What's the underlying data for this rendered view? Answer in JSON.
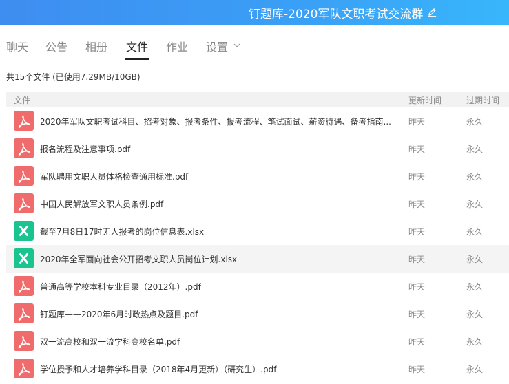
{
  "header": {
    "title": "钉题库-2020军队文职考试交流群"
  },
  "tabs": [
    {
      "label": "聊天"
    },
    {
      "label": "公告"
    },
    {
      "label": "相册"
    },
    {
      "label": "文件",
      "active": true
    },
    {
      "label": "作业"
    },
    {
      "label": "设置"
    }
  ],
  "summary": "共15个文件 (已使用7.29MB/10GB)",
  "table": {
    "columns": {
      "file": "文件",
      "updated": "更新时间",
      "expires": "过期时间"
    },
    "rows": [
      {
        "icon": "pdf-file-icon",
        "name": "2020年军队文职考试科目、招考对象、报考条件、报考流程、笔试面试、薪资待遇、备考指南...",
        "updated": "昨天",
        "expires": "永久"
      },
      {
        "icon": "pdf-file-icon",
        "name": "报名流程及注意事项.pdf",
        "updated": "昨天",
        "expires": "永久"
      },
      {
        "icon": "pdf-file-icon",
        "name": "军队聘用文职人员体格检查通用标准.pdf",
        "updated": "昨天",
        "expires": "永久"
      },
      {
        "icon": "pdf-file-icon",
        "name": "中国人民解放军文职人员条例.pdf",
        "updated": "昨天",
        "expires": "永久"
      },
      {
        "icon": "excel-file-icon",
        "name": "截至7月8日17时无人报考的岗位信息表.xlsx",
        "updated": "昨天",
        "expires": "永久"
      },
      {
        "icon": "excel-file-icon",
        "name": "2020年全军面向社会公开招考文职人员岗位计划.xlsx",
        "updated": "昨天",
        "expires": "永久"
      },
      {
        "icon": "pdf-file-icon",
        "name": "普通高等学校本科专业目录（2012年）.pdf",
        "updated": "昨天",
        "expires": "永久"
      },
      {
        "icon": "pdf-file-icon",
        "name": "钉题库——2020年6月时政热点及题目.pdf",
        "updated": "昨天",
        "expires": "永久"
      },
      {
        "icon": "pdf-file-icon",
        "name": "双一流高校和双一流学科高校名单.pdf",
        "updated": "昨天",
        "expires": "永久"
      },
      {
        "icon": "pdf-file-icon",
        "name": "学位授予和人才培养学科目录（2018年4月更新）（研究生）.pdf",
        "updated": "昨天",
        "expires": "永久"
      }
    ]
  },
  "colors": {
    "header": "#3aa0f6",
    "pdf": "#f06b6b",
    "excel": "#19c48f"
  }
}
